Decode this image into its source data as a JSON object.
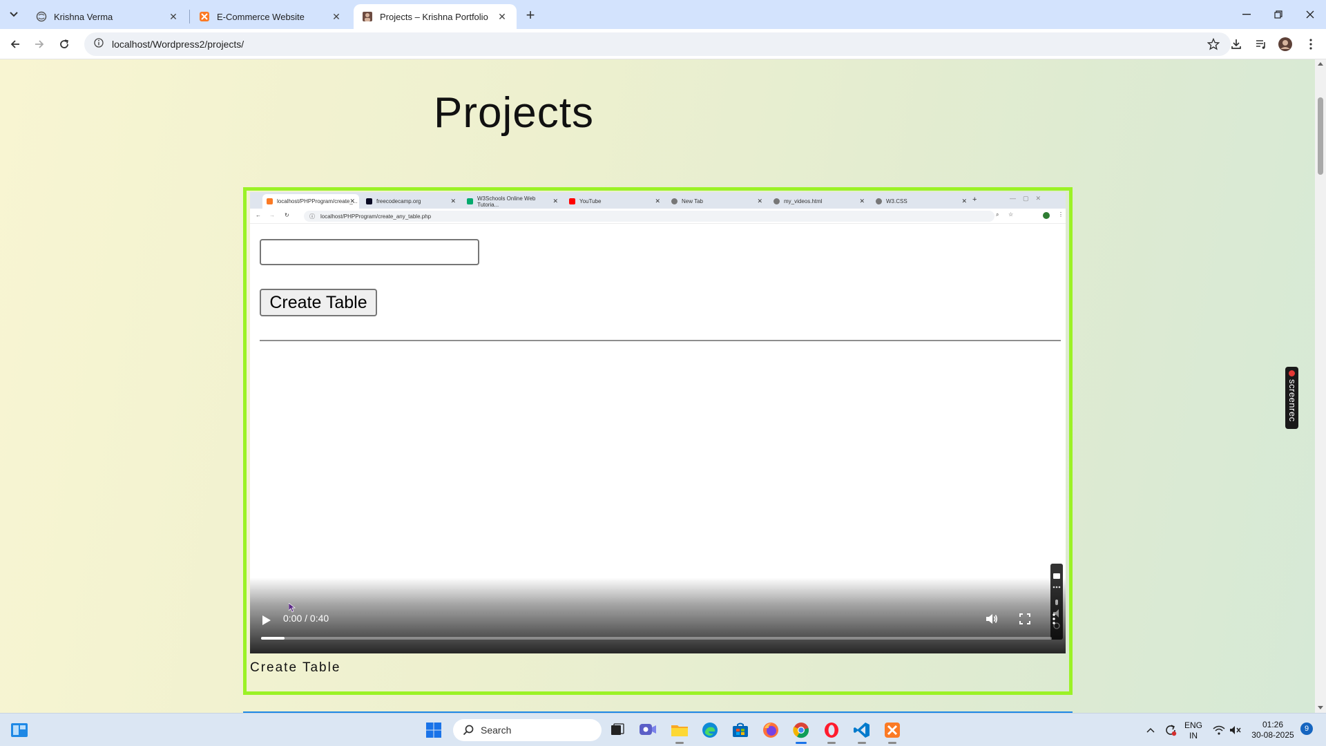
{
  "browser": {
    "tabs": [
      {
        "label": "Krishna Verma",
        "icon": "globe-icon"
      },
      {
        "label": "E-Commerce Website",
        "icon": "xampp-icon"
      },
      {
        "label": "Projects – Krishna Portfolio",
        "icon": "profile-favicon-icon"
      }
    ],
    "url": "localhost/Wordpress2/projects/"
  },
  "page": {
    "title": "Projects",
    "project": {
      "caption": "Create Table",
      "video": {
        "time": "0:00 / 0:40",
        "progress": 0.03,
        "recorded": {
          "tabs": [
            "localhost/PHPProgram/create_...",
            "freecodecamp.org",
            "W3Schools Online Web Tutoria...",
            "YouTube",
            "New Tab",
            "my_videos.html",
            "W3.CSS"
          ],
          "url": "localhost/PHPProgram/create_any_table.php",
          "button_label": "Create Table"
        }
      }
    }
  },
  "overlay": {
    "screenrec_label": "screenrec"
  },
  "taskbar": {
    "search_placeholder": "Search",
    "lang_top": "ENG",
    "lang_bottom": "IN",
    "time": "01:26",
    "date": "30-08-2025",
    "notification_count": "9"
  },
  "colors": {
    "card_border": "#9bf226",
    "accent_line": "#1e88e5"
  }
}
